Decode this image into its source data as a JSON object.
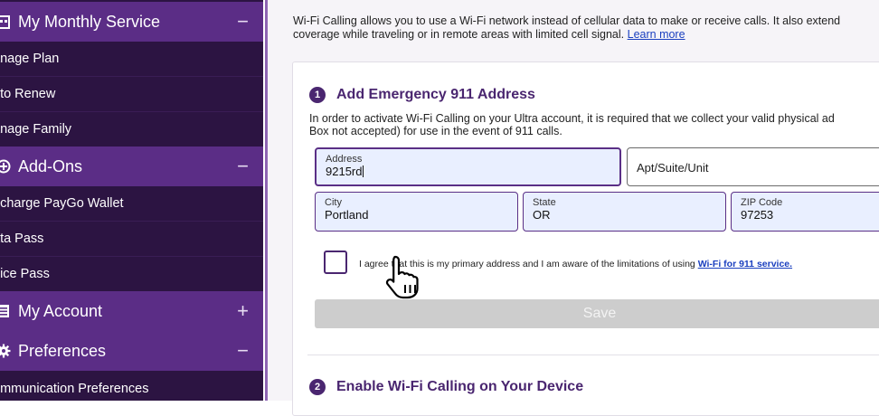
{
  "sidebar": {
    "sections": [
      {
        "label": "My Monthly Service",
        "toggle": "−",
        "icon": "calendar-icon"
      },
      {
        "label": "Add-Ons",
        "toggle": "−",
        "icon": "circle-plus-icon"
      },
      {
        "label": "My Account",
        "toggle": "+",
        "icon": "account-card-icon"
      },
      {
        "label": "Preferences",
        "toggle": "−",
        "icon": "gear-icon"
      }
    ],
    "items": [
      {
        "label": "anage Plan"
      },
      {
        "label": "uto Renew"
      },
      {
        "label": "anage Family"
      },
      {
        "label": "echarge PayGo Wallet"
      },
      {
        "label": "ata Pass"
      },
      {
        "label": "oice Pass"
      },
      {
        "label": "ommunication Preferences"
      }
    ]
  },
  "main": {
    "intro_line1": "Wi-Fi Calling allows you to use a Wi-Fi network instead of cellular data to make or receive calls. It also extend",
    "intro_line2": "coverage while traveling or in remote areas with limited cell signal.",
    "learn_more": "Learn more",
    "step1": {
      "number": "1",
      "title": "Add Emergency 911 Address",
      "desc_line1": "In order to activate Wi-Fi Calling on your Ultra account, it is required that we collect your valid physical ad",
      "desc_line2": "Box not accepted) for use in the event of 911 calls."
    },
    "form": {
      "address_label": "Address",
      "address_value": "9215rd",
      "apt_placeholder": "Apt/Suite/Unit",
      "city_label": "City",
      "city_value": "Portland",
      "state_label": "State",
      "state_value": "OR",
      "zip_label": "ZIP Code",
      "zip_value": "97253",
      "agree_text": "I agree that this is my primary address and I am aware of the limitations of using",
      "agree_link": "Wi-Fi for 911 service.",
      "save_label": "Save"
    },
    "step2": {
      "number": "2",
      "title": "Enable Wi-Fi Calling on Your Device"
    }
  },
  "colors": {
    "sidebar_bg": "#2c1442",
    "section_bg": "#5b2d86",
    "accent": "#4a2670",
    "link": "#1a3fbf",
    "field_fill": "#e9efff"
  }
}
